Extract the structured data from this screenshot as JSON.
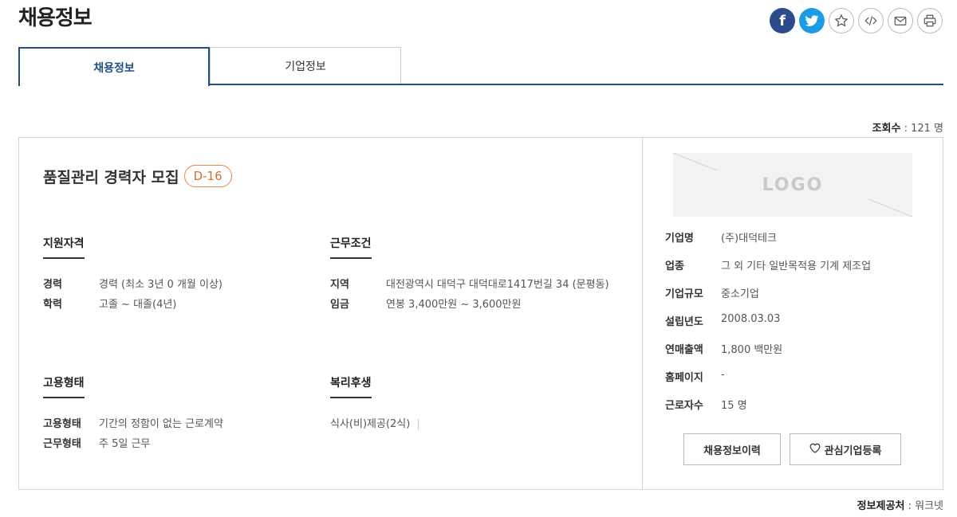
{
  "page_title": "채용정보",
  "tabs": [
    {
      "label": "채용정보",
      "active": true
    },
    {
      "label": "기업정보",
      "active": false
    }
  ],
  "share_icons": [
    "facebook-icon",
    "twitter-icon",
    "star-icon",
    "embed-code-icon",
    "mail-icon",
    "print-icon"
  ],
  "facebook_glyph": "f",
  "views": {
    "label": "조회수",
    "value": "121 명"
  },
  "job": {
    "title": "품질관리 경력자 모집",
    "dday": "D-16"
  },
  "sections": {
    "qualification": {
      "title": "지원자격",
      "rows": [
        {
          "k": "경력",
          "v": "경력 (최소 3년 0 개월 이상)"
        },
        {
          "k": "학력",
          "v": "고졸 ~ 대졸(4년)"
        }
      ]
    },
    "conditions": {
      "title": "근무조건",
      "rows": [
        {
          "k": "지역",
          "v": "대전광역시 대덕구 대덕대로1417번길 34 (문평동)"
        },
        {
          "k": "임금",
          "v": "연봉 3,400만원 ~ 3,600만원"
        }
      ]
    },
    "employment": {
      "title": "고용형태",
      "rows": [
        {
          "k": "고용형태",
          "v": "기간의 정함이 없는 근로계약"
        },
        {
          "k": "근무형태",
          "v": "주 5일 근무"
        }
      ]
    },
    "welfare": {
      "title": "복리후생",
      "text": "식사(비)제공(2식)"
    }
  },
  "company": {
    "logo_text": "LOGO",
    "rows": [
      {
        "k": "기업명",
        "v": "(주)대덕테크"
      },
      {
        "k": "업종",
        "v": "그 외 기타 일반목적용 기계 제조업"
      },
      {
        "k": "기업규모",
        "v": "중소기업"
      },
      {
        "k": "설립년도",
        "v": "2008.03.03"
      },
      {
        "k": "연매출액",
        "v": "1,800 백만원"
      },
      {
        "k": "홈페이지",
        "v": "-"
      },
      {
        "k": "근로자수",
        "v": "15 명"
      }
    ],
    "history_button": "채용정보이력",
    "favorite_button": "관심기업등록"
  },
  "source": {
    "label": "정보제공처",
    "value": "워크넷"
  },
  "colors": {
    "accent": "#1f4f85",
    "dday": "#d4702c",
    "facebook": "#2d4a8a",
    "twitter": "#1d9be6"
  }
}
